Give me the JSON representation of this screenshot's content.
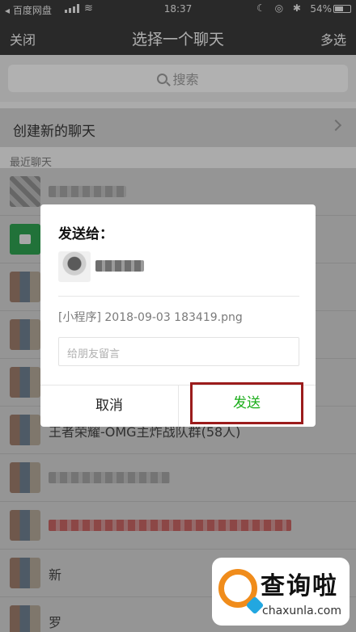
{
  "status_bar": {
    "carrier": "◂ 百度网盘",
    "time": "18:37",
    "battery": "54%"
  },
  "nav": {
    "left": "关闭",
    "title": "选择一个聊天",
    "right": "多选"
  },
  "search": {
    "placeholder": "搜索"
  },
  "new_chat": {
    "label": "创建新的聊天"
  },
  "section_label": "最近聊天",
  "list": [
    {
      "name": ""
    },
    {
      "name": ""
    },
    {
      "name": ""
    },
    {
      "name": ""
    },
    {
      "name": ""
    },
    {
      "name": "王者荣耀-OMG主炸战队群(58人)"
    },
    {
      "name": ""
    },
    {
      "name": ""
    },
    {
      "name": "新"
    },
    {
      "name": "罗"
    }
  ],
  "modal": {
    "heading": "发送给：",
    "file": "[小程序] 2018-09-03 183419.png",
    "message_placeholder": "给朋友留言",
    "cancel": "取消",
    "send": "发送"
  },
  "watermark": {
    "name_cn": "查询啦",
    "name_en": "chaxunla.com"
  },
  "colors": {
    "send": "#1aad19",
    "highlight_border": "#9b1c1c",
    "nav_bg": "#3a3a3a"
  }
}
